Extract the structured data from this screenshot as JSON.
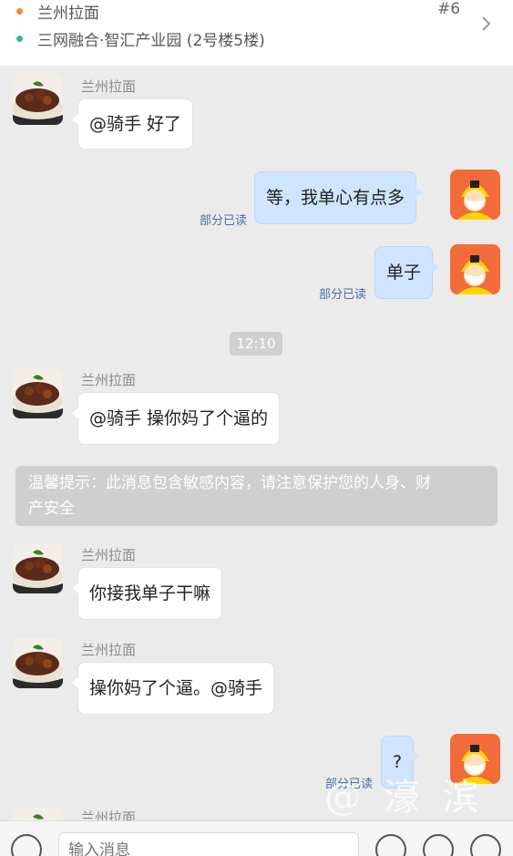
{
  "header": {
    "shop": "兰州拉面",
    "address": "三网融合·智汇产业园 (2号楼5楼)",
    "order_no": "#6",
    "shop_dot_color": "#f08a3c",
    "address_dot_color": "#2fb88a"
  },
  "messages": [
    {
      "sender": "兰州拉面",
      "text": "@骑手 好了"
    },
    {
      "text": "等，我单心有点多",
      "read": "部分已读"
    },
    {
      "text": "单子",
      "read": "部分已读"
    },
    {
      "time": "12:10"
    },
    {
      "sender": "兰州拉面",
      "text": "@骑手 操你妈了个逼的"
    },
    {
      "notice": "温馨提示：此消息包含敏感内容，请注意保护您的人身、财产安全"
    },
    {
      "sender": "兰州拉面",
      "text": "你接我单子干嘛"
    },
    {
      "sender": "兰州拉面",
      "text": "操你妈了个逼。@骑手"
    },
    {
      "text": "?",
      "read": "部分已读"
    },
    {
      "sender": "兰州拉面"
    }
  ],
  "notice_lines": [
    "温馨提示：此消息包含敏感内容，请注意保护您的人身、财",
    "产安全"
  ],
  "watermark": "@ 濠 滨",
  "input": {
    "placeholder": "输入消息"
  },
  "icons": {
    "shop_avatar": "beef-noodle-bowl-image",
    "rider_avatar": "rider-cartoon-avatar",
    "chevron": "chevron-right-icon",
    "voice": "microphone-icon",
    "emoji": "emoji-icon",
    "quick_reply": "quick-reply-icon",
    "more": "plus-icon"
  }
}
